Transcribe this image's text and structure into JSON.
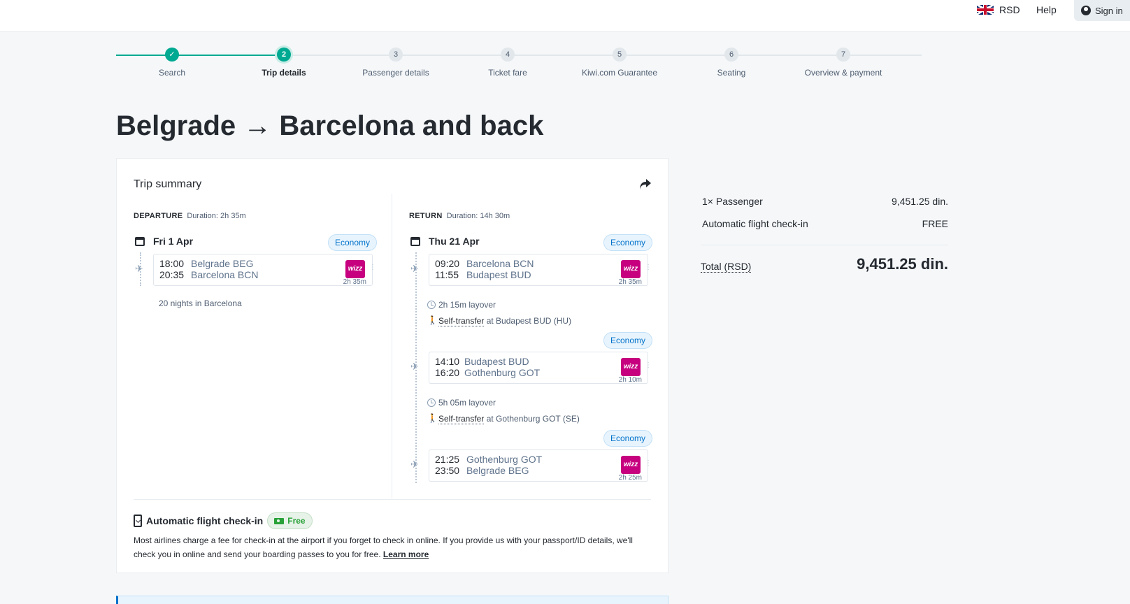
{
  "header": {
    "currency": "RSD",
    "help": "Help",
    "sign_in": "Sign in"
  },
  "steps": [
    {
      "num": "✓",
      "label": "Search",
      "state": "done"
    },
    {
      "num": "2",
      "label": "Trip details",
      "state": "active"
    },
    {
      "num": "3",
      "label": "Passenger details",
      "state": "todo"
    },
    {
      "num": "4",
      "label": "Ticket fare",
      "state": "todo"
    },
    {
      "num": "5",
      "label": "Kiwi.com Guarantee",
      "state": "todo"
    },
    {
      "num": "6",
      "label": "Seating",
      "state": "todo"
    },
    {
      "num": "7",
      "label": "Overview & payment",
      "state": "todo"
    }
  ],
  "page_title": "Belgrade → Barcelona and back",
  "trip": {
    "title": "Trip summary",
    "departure": {
      "label": "DEPARTURE",
      "duration": "Duration: 2h 35m",
      "date": "Fri 1 Apr",
      "cabin": "Economy",
      "flights": [
        {
          "dep_time": "18:00",
          "arr_time": "20:35",
          "from": "Belgrade BEG",
          "to": "Barcelona BCN",
          "duration": "2h 35m",
          "airline": "wizz"
        }
      ],
      "stay": "20 nights in Barcelona"
    },
    "return": {
      "label": "RETURN",
      "duration": "Duration: 14h 30m",
      "date": "Thu 21 Apr",
      "flights": [
        {
          "cabin": "Economy",
          "dep_time": "09:20",
          "arr_time": "11:55",
          "from": "Barcelona BCN",
          "to": "Budapest BUD",
          "duration": "2h 35m",
          "airline": "wizz"
        },
        {
          "cabin": "Economy",
          "dep_time": "14:10",
          "arr_time": "16:20",
          "from": "Budapest BUD",
          "to": "Gothenburg GOT",
          "duration": "2h 10m",
          "airline": "wizz"
        },
        {
          "cabin": "Economy",
          "dep_time": "21:25",
          "arr_time": "23:50",
          "from": "Gothenburg GOT",
          "to": "Belgrade BEG",
          "duration": "2h 25m",
          "airline": "wizz"
        }
      ],
      "layovers": [
        {
          "duration": "2h 15m layover",
          "transfer_label": "Self-transfer",
          "transfer_place": "at Budapest BUD (HU)"
        },
        {
          "duration": "5h 05m layover",
          "transfer_label": "Self-transfer",
          "transfer_place": "at Gothenburg GOT (SE)"
        }
      ]
    },
    "checkin": {
      "title": "Automatic flight check-in",
      "badge": "Free",
      "text": "Most airlines charge a fee for check-in at the airport if you forget to check in online. If you provide us with your passport/ID details, we'll check you in online and send your boarding passes to you for free.",
      "link": "Learn more"
    }
  },
  "price": {
    "passenger_label": "1× Passenger",
    "passenger_value": "9,451.25 din.",
    "checkin_label": "Automatic flight check-in",
    "checkin_value": "FREE",
    "total_label": "Total (RSD)",
    "total_value": "9,451.25 din."
  },
  "colors": {
    "accent": "#00a991",
    "wizz": "#c6007e",
    "info_blue": "#0172cb"
  }
}
